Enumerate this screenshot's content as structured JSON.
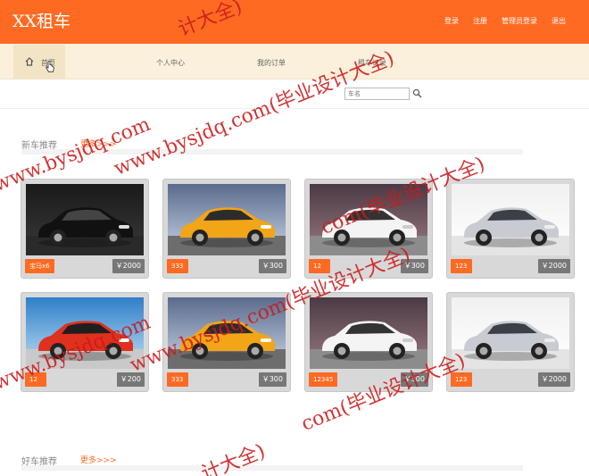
{
  "header": {
    "logo": "XX租车",
    "links": [
      "登录",
      "注册",
      "管理员登录",
      "退出"
    ]
  },
  "nav": {
    "items": [
      "首页",
      "个人中心",
      "我的订单",
      "租车记录"
    ]
  },
  "search": {
    "placeholder": "车名"
  },
  "sections": {
    "new": {
      "title": "新车推荐",
      "more": "更多>>>"
    },
    "good": {
      "title": "好车推荐",
      "more": "更多>>>"
    }
  },
  "cars": [
    {
      "name": "宝马x6",
      "price": "￥2000",
      "style": "audi-black"
    },
    {
      "name": "333",
      "price": "￥300",
      "style": "tt-yellow"
    },
    {
      "name": "12",
      "price": "￥300",
      "style": "a8-white"
    },
    {
      "name": "123",
      "price": "￥2000",
      "style": "kia-silver"
    },
    {
      "name": "12",
      "price": "￥200",
      "style": "bmw-red"
    },
    {
      "name": "333",
      "price": "￥300",
      "style": "tt-yellow"
    },
    {
      "name": "12345",
      "price": "￥300",
      "style": "a8-white"
    },
    {
      "name": "123",
      "price": "￥2000",
      "style": "kia-silver"
    }
  ],
  "watermark": {
    "url": "www.bysjdq.com",
    "tagged": "www.bysjdq.com(毕业设计大全)",
    "short": "计大全)",
    "partial": "com(毕业设计大全)",
    "color": "#cc1a1a"
  },
  "colors": {
    "accent": "#ff6a22",
    "nav_bg": "#fbf0dc"
  }
}
